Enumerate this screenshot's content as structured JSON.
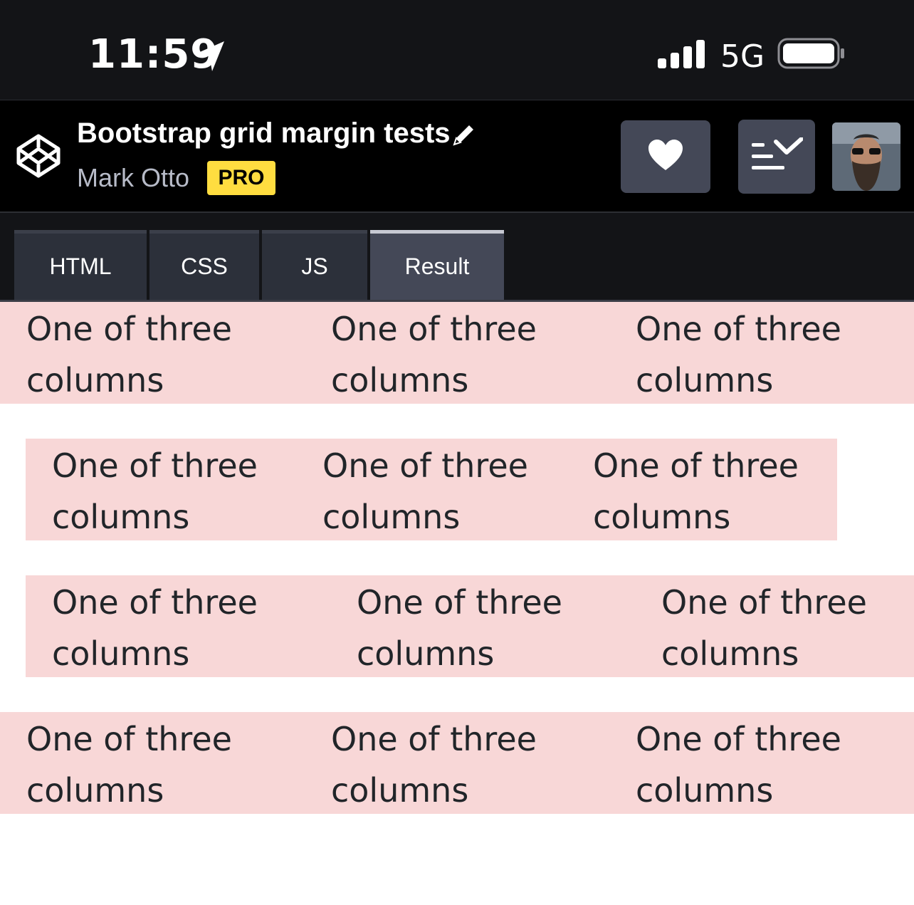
{
  "status_bar": {
    "time": "11:59",
    "network": "5G",
    "icons": [
      "location-arrow-icon",
      "cellular-signal-icon",
      "battery-icon"
    ]
  },
  "header": {
    "title": "Bootstrap grid margin tests",
    "author": "Mark Otto",
    "badge": "PRO",
    "icons": [
      "codepen-logo-icon",
      "pencil-icon",
      "heart-icon",
      "list-view-icon"
    ],
    "colors": {
      "badge": "#ffdd40",
      "button": "#444857",
      "background": "#000000"
    }
  },
  "tabs": [
    {
      "label": "HTML",
      "active": false
    },
    {
      "label": "CSS",
      "active": false
    },
    {
      "label": "JS",
      "active": false
    },
    {
      "label": "Result",
      "active": true
    }
  ],
  "result": {
    "rows": [
      {
        "columns": [
          "One of three columns",
          "One of three columns",
          "One of three columns"
        ]
      },
      {
        "columns": [
          "One of three columns",
          "One of three columns",
          "One of three columns"
        ]
      },
      {
        "columns": [
          "One of three columns",
          "One of three columns",
          "One of three columns"
        ]
      },
      {
        "columns": [
          "One of three columns",
          "One of three columns",
          "One of three columns"
        ]
      }
    ],
    "colors": {
      "row_background": "#f8d7d7",
      "text": "#212529"
    }
  }
}
